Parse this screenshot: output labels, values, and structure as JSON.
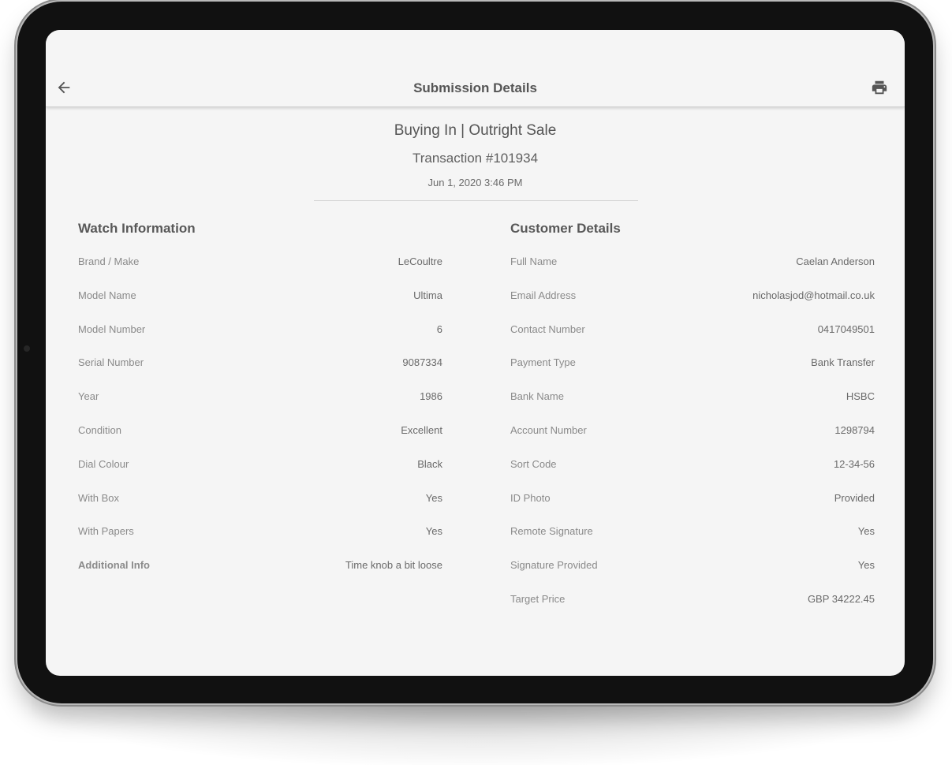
{
  "appbar": {
    "title": "Submission Details",
    "back_icon": "arrow-back-icon",
    "print_icon": "print-icon"
  },
  "header": {
    "line1": "Buying In | Outright Sale",
    "line2": "Transaction #101934",
    "date": "Jun 1, 2020 3:46 PM"
  },
  "watch": {
    "title": "Watch Information",
    "rows": [
      {
        "label": "Brand / Make",
        "value": "LeCoultre"
      },
      {
        "label": "Model Name",
        "value": "Ultima"
      },
      {
        "label": "Model Number",
        "value": "6"
      },
      {
        "label": "Serial Number",
        "value": "9087334"
      },
      {
        "label": "Year",
        "value": "1986"
      },
      {
        "label": "Condition",
        "value": "Excellent"
      },
      {
        "label": "Dial Colour",
        "value": "Black"
      },
      {
        "label": "With Box",
        "value": "Yes"
      },
      {
        "label": "With Papers",
        "value": "Yes"
      },
      {
        "label": "Additional Info",
        "value": "Time knob a bit loose"
      }
    ]
  },
  "customer": {
    "title": "Customer Details",
    "rows": [
      {
        "label": "Full Name",
        "value": "Caelan Anderson"
      },
      {
        "label": "Email Address",
        "value": "nicholasjod@hotmail.co.uk"
      },
      {
        "label": "Contact Number",
        "value": "0417049501"
      },
      {
        "label": "Payment Type",
        "value": "Bank Transfer"
      },
      {
        "label": "Bank Name",
        "value": "HSBC"
      },
      {
        "label": "Account Number",
        "value": "1298794"
      },
      {
        "label": "Sort Code",
        "value": "12-34-56"
      },
      {
        "label": "ID Photo",
        "value": "Provided"
      },
      {
        "label": "Remote Signature",
        "value": "Yes"
      },
      {
        "label": "Signature Provided",
        "value": "Yes"
      },
      {
        "label": "Target Price",
        "value": "GBP 34222.45"
      }
    ]
  },
  "colors": {
    "screen_bg": "#f5f5f5",
    "bezel": "#111111",
    "text_primary": "#555555",
    "text_label": "#8a8a8a"
  }
}
